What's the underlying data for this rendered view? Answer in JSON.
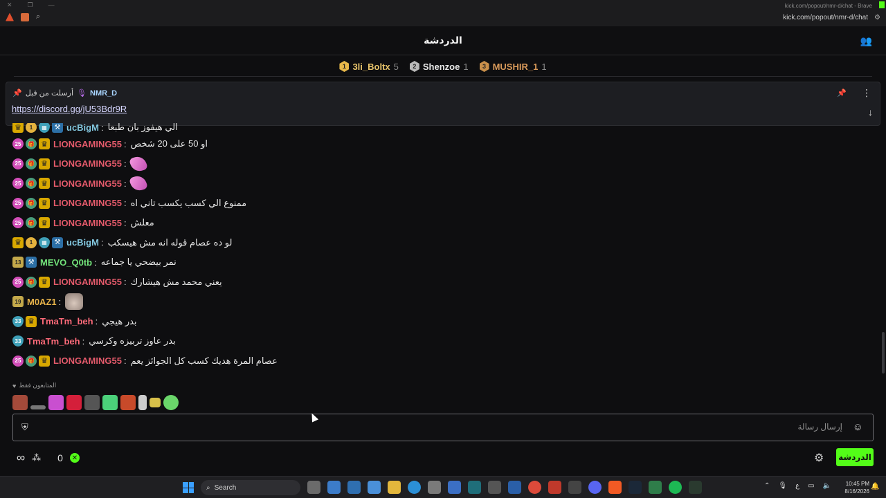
{
  "browser": {
    "title_right": "kick.com/popout/nmr-d/chat - Brave",
    "url": "kick.com/popout/nmr-d/chat"
  },
  "header": {
    "title": "الدردشة"
  },
  "leaderboard": [
    {
      "rank": "1",
      "name": "3li_Boltx",
      "count": "5",
      "color": "#e7c36a"
    },
    {
      "rank": "2",
      "name": "Shenzoe",
      "count": "1",
      "color": "#e8e8e8"
    },
    {
      "rank": "3",
      "name": "MUSHIR_1",
      "count": "1",
      "color": "#d99a5a"
    }
  ],
  "pinned": {
    "label": "أرسلت من قبل",
    "user": "NMR_D",
    "link": "https://discord.gg/jU53Bdr9R"
  },
  "messages": [
    {
      "user": "ucBigM",
      "text": "الي هيفوز بان طبعا",
      "color": "c-cyan",
      "badges": [
        "crown",
        "gold1",
        "cyan",
        "tool"
      ]
    },
    {
      "user": "LIONGAMING55",
      "text": "او 50 على 20 شخص",
      "color": "c-red",
      "badges": [
        "sub",
        "gift",
        "crown"
      ]
    },
    {
      "user": "LIONGAMING55",
      "text": "",
      "color": "c-red",
      "badges": [
        "sub",
        "gift",
        "crown"
      ],
      "emote": "pink"
    },
    {
      "user": "LIONGAMING55",
      "text": "",
      "color": "c-red",
      "badges": [
        "sub",
        "gift",
        "crown"
      ],
      "emote": "pink"
    },
    {
      "user": "LIONGAMING55",
      "text": "ممنوع الي كسب يكسب تاني اه",
      "color": "c-red",
      "badges": [
        "sub",
        "gift",
        "crown"
      ]
    },
    {
      "user": "LIONGAMING55",
      "text": "معلش",
      "color": "c-red",
      "badges": [
        "sub",
        "gift",
        "crown"
      ]
    },
    {
      "user": "ucBigM",
      "text": "لو ده عصام قوله انه مش هيسكب",
      "color": "c-cyan",
      "badges": [
        "crown",
        "gold1",
        "cyan",
        "tool"
      ]
    },
    {
      "user": "MEVO_Q0tb",
      "text": "نمر بيضحي يا جماعه",
      "color": "c-green",
      "badges": [
        "num13",
        "tool"
      ]
    },
    {
      "user": "LIONGAMING55",
      "text": "يعني محمد مش هيشارك",
      "color": "c-red",
      "badges": [
        "sub",
        "gift",
        "crown"
      ]
    },
    {
      "user": "M0AZ1",
      "text": "",
      "color": "c-yellow",
      "badges": [
        "num19"
      ],
      "emote": "cat"
    },
    {
      "user": "TmaTm_beh",
      "text": "بدر هيجي",
      "color": "c-pink",
      "badges": [
        "shield33",
        "crown"
      ]
    },
    {
      "user": "TmaTm_beh",
      "text": "بدر عاوز تربيزه وكرسي",
      "color": "c-pink",
      "badges": [
        "shield33"
      ]
    },
    {
      "user": "LIONGAMING55",
      "text": "عصام المرة هديك كسب كل الجوائز يعم",
      "color": "c-red",
      "badges": [
        "sub",
        "gift",
        "crown"
      ]
    }
  ],
  "badge_text": {
    "sub": "25",
    "gold1": "1",
    "num13": "13",
    "num19": "19",
    "shield33": "33"
  },
  "emote_bar": {
    "label": "المتابعون فقط"
  },
  "input": {
    "placeholder": "إرسال رسالة"
  },
  "footer": {
    "count": "0",
    "chat_button": "الدردشة"
  },
  "taskbar": {
    "search": "Search",
    "time": "10:45 PM",
    "date": "8/16/2026",
    "lang": "ع"
  }
}
